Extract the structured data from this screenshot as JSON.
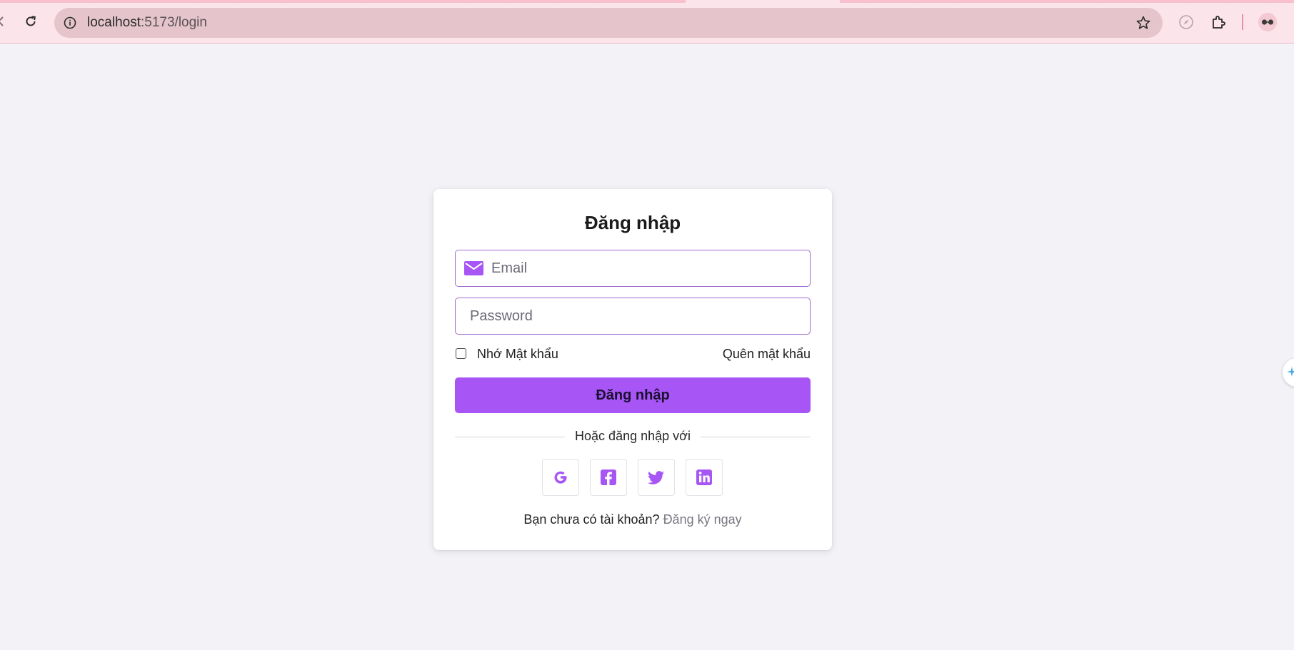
{
  "browser": {
    "url_host": "localhost",
    "url_path": ":5173/login"
  },
  "login": {
    "title": "Đăng nhập",
    "email_placeholder": "Email",
    "password_placeholder": "Password",
    "remember_label": "Nhớ Mật khẩu",
    "forgot_label": "Quên mật khẩu",
    "submit_label": "Đăng nhập",
    "divider_text": "Hoặc đăng nhập với",
    "social_icons": [
      "google-icon",
      "facebook-icon",
      "twitter-icon",
      "linkedin-icon"
    ],
    "signup_prompt": "Bạn chưa có tài khoản?",
    "signup_link": "Đăng ký ngay"
  },
  "colors": {
    "accent": "#a756f5",
    "page_background": "#f3f2f7",
    "chrome_background": "#fbe4ea",
    "input_border": "#a06ad0"
  }
}
